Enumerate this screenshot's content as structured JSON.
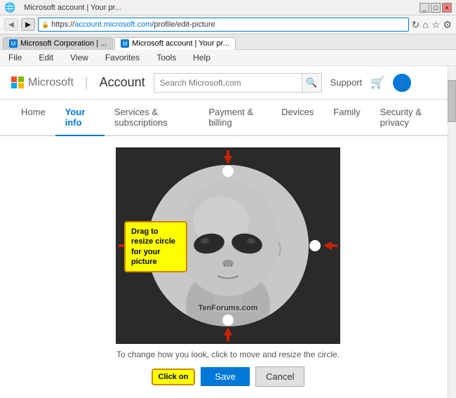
{
  "window": {
    "title": "Microsoft account | Your pr...",
    "url": "https://account.microsoft.com/profile/edit-picture",
    "url_prefix": "https://",
    "url_domain": "account.microsoft.com",
    "url_path": "/profile/edit-picture"
  },
  "tabs": [
    {
      "label": "Microsoft Corporation | ...",
      "active": false
    },
    {
      "label": "Microsoft account | Your pr...",
      "active": true
    }
  ],
  "menu": {
    "items": [
      "File",
      "Edit",
      "View",
      "Favorites",
      "Tools",
      "Help"
    ]
  },
  "header": {
    "logo_text": "Microsoft",
    "divider": "|",
    "account_text": "Account",
    "search_placeholder": "Search Microsoft.com",
    "support_text": "Support"
  },
  "nav": {
    "items": [
      {
        "label": "Home",
        "active": false
      },
      {
        "label": "Your info",
        "active": true
      },
      {
        "label": "Services & subscriptions",
        "active": false
      },
      {
        "label": "Payment & billing",
        "active": false
      },
      {
        "label": "Devices",
        "active": false
      },
      {
        "label": "Family",
        "active": false
      },
      {
        "label": "Security & privacy",
        "active": false
      }
    ]
  },
  "editPicture": {
    "drag_tooltip": "Drag to resize circle for your picture",
    "caption": "To change how you look, click to move and resize the circle.",
    "watermark": "TenForums.com",
    "click_tooltip": "Click on",
    "save_label": "Save",
    "cancel_label": "Cancel"
  }
}
